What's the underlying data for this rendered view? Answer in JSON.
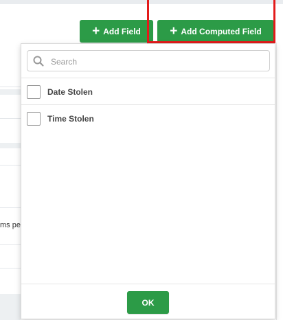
{
  "toolbar": {
    "add_field_label": "Add Field",
    "add_computed_field_label": "Add Computed Field",
    "accent_color": "#2c9b47",
    "highlight_color": "#e31a1a"
  },
  "background": {
    "partial_text": "ms pe"
  },
  "dropdown": {
    "search_placeholder": "Search",
    "search_value": "",
    "options": [
      {
        "label": "Date Stolen",
        "checked": false
      },
      {
        "label": "Time Stolen",
        "checked": false
      }
    ],
    "ok_label": "OK"
  },
  "icons": {
    "search": "search-icon",
    "add": "plus-icon"
  }
}
